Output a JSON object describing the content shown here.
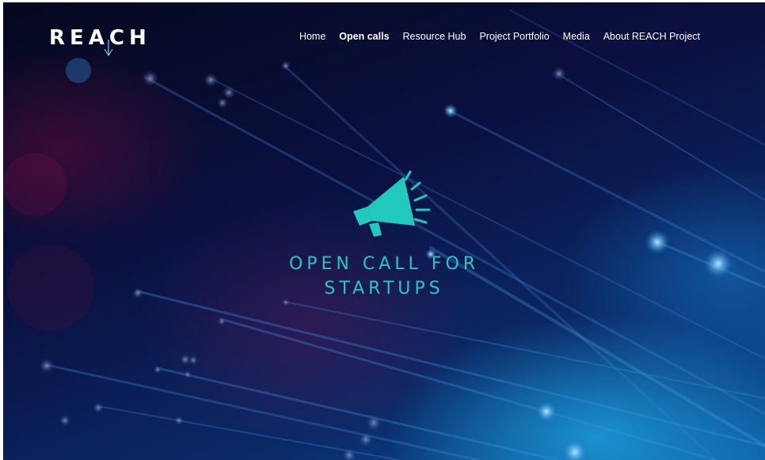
{
  "brand": {
    "logo_text": "REACH"
  },
  "nav": {
    "items": [
      {
        "label": "Home",
        "active": false
      },
      {
        "label": "Open calls",
        "active": true
      },
      {
        "label": "Resource Hub",
        "active": false
      },
      {
        "label": "Project Portfolio",
        "active": false
      },
      {
        "label": "Media",
        "active": false
      },
      {
        "label": "About REACH Project",
        "active": false
      }
    ]
  },
  "hero": {
    "icon": "megaphone-icon",
    "title_line1": "OPEN CALL FOR",
    "title_line2": "STARTUPS",
    "accent_color": "#27c6c0"
  }
}
